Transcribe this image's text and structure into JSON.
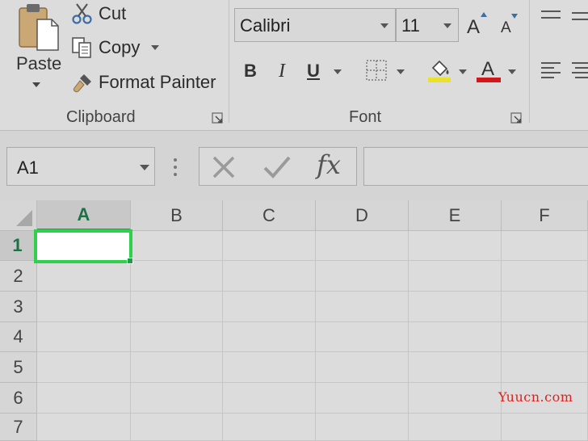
{
  "clipboard": {
    "paste_label": "Paste",
    "cut_label": "Cut",
    "copy_label": "Copy",
    "format_painter_label": "Format Painter",
    "group_label": "Clipboard"
  },
  "font": {
    "font_name": "Calibri",
    "font_size": "11",
    "group_label": "Font",
    "bold_label": "B",
    "italic_label": "I",
    "underline_label": "U",
    "grow_label": "A",
    "shrink_label": "A",
    "font_color_label": "A",
    "highlight_color": "#e8e22a",
    "font_color": "#d0181c"
  },
  "formula_bar": {
    "name_box": "A1",
    "fx_label": "fx"
  },
  "grid": {
    "columns": [
      "A",
      "B",
      "C",
      "D",
      "E",
      "F"
    ],
    "rows": [
      "1",
      "2",
      "3",
      "4",
      "5",
      "6",
      "7"
    ],
    "active_cell": "A1",
    "active_color": "#2fd04b"
  },
  "watermark": "Yuucn.com"
}
